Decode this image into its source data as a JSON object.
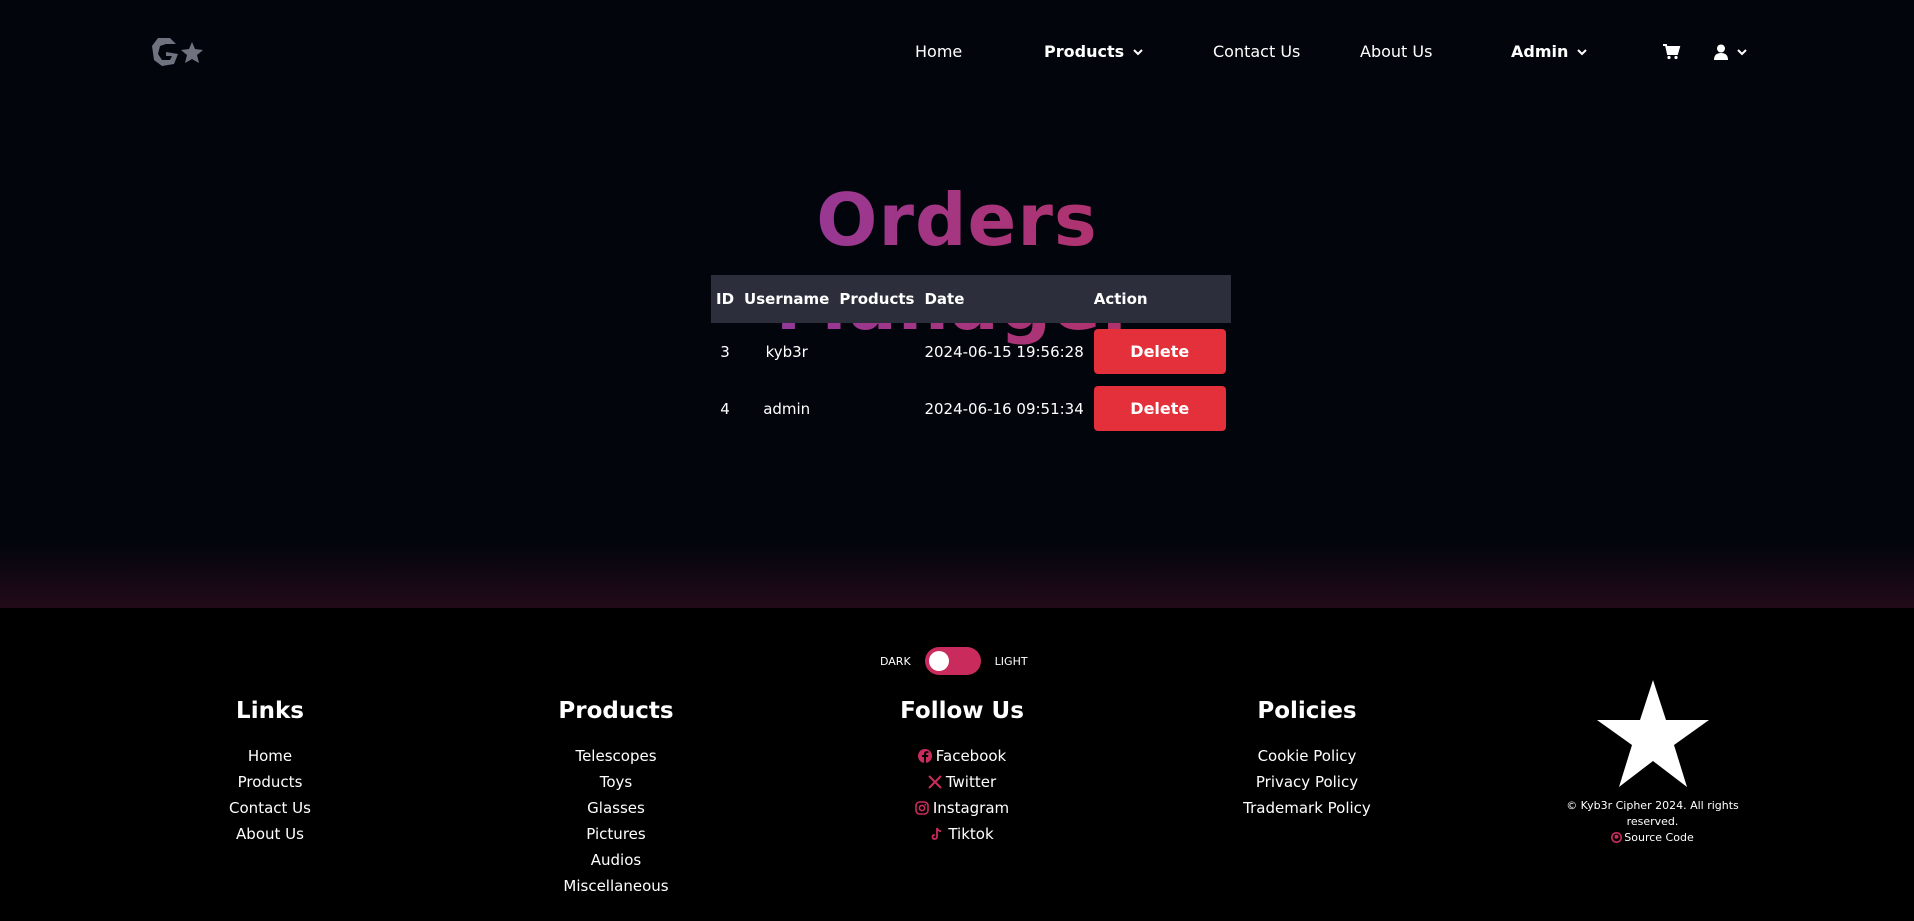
{
  "nav": {
    "logo_icon": "g-star-logo-icon",
    "home": "Home",
    "products": "Products",
    "contact": "Contact Us",
    "about": "About Us",
    "admin": "Admin",
    "cart_icon": "cart-icon",
    "user_icon": "user-icon"
  },
  "main": {
    "title": "Orders Manager",
    "columns": [
      "ID",
      "Username",
      "Products",
      "Date",
      "Action"
    ],
    "rows": [
      {
        "id": "3",
        "username": "kyb3r",
        "products": "",
        "date": "2024-06-15 19:56:28",
        "action": "Delete"
      },
      {
        "id": "4",
        "username": "admin",
        "products": "",
        "date": "2024-06-16 09:51:34",
        "action": "Delete"
      }
    ]
  },
  "footer": {
    "theme": {
      "dark": "DARK",
      "light": "LIGHT"
    },
    "links": {
      "title": "Links",
      "items": [
        "Home",
        "Products",
        "Contact Us",
        "About Us"
      ]
    },
    "products": {
      "title": "Products",
      "items": [
        "Telescopes",
        "Toys",
        "Glasses",
        "Pictures",
        "Audios",
        "Miscellaneous"
      ]
    },
    "follow": {
      "title": "Follow Us",
      "items": [
        "Facebook",
        "Twitter",
        "Instagram",
        "Tiktok"
      ]
    },
    "policies": {
      "title": "Policies",
      "items": [
        "Cookie Policy",
        "Privacy Policy",
        "Trademark Policy"
      ]
    },
    "copyright": "© Kyb3r Cipher 2024. All rights reserved.",
    "source_code": "Source Code"
  },
  "colors": {
    "background": "#03050c",
    "accent": "#c92c5c",
    "delete": "#e3303a",
    "table_header": "#2c2f3b"
  }
}
